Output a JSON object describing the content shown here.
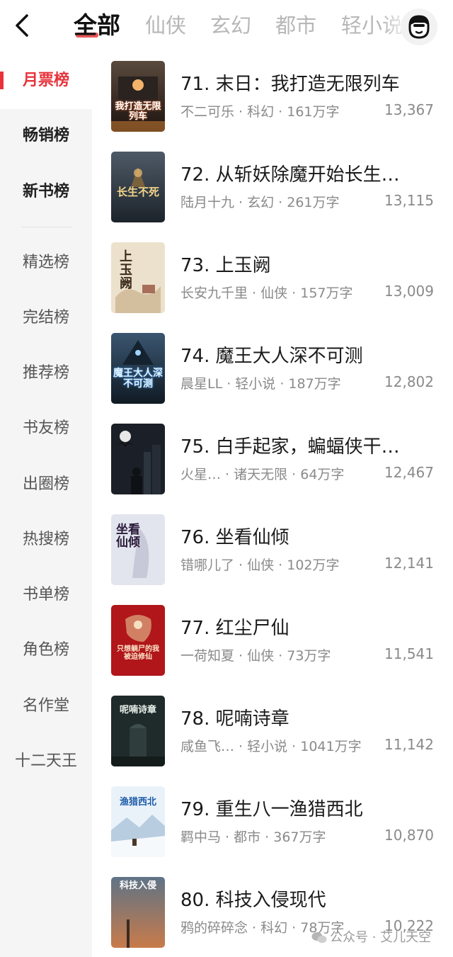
{
  "tabs": [
    {
      "label": "全部",
      "active": true
    },
    {
      "label": "仙侠"
    },
    {
      "label": "玄幻"
    },
    {
      "label": "都市"
    },
    {
      "label": "轻小说"
    }
  ],
  "sidebar": {
    "items": [
      {
        "label": "月票榜",
        "state": "active"
      },
      {
        "label": "畅销榜",
        "state": "bold"
      },
      {
        "label": "新书榜",
        "state": "bold"
      },
      {
        "label": "精选榜"
      },
      {
        "label": "完结榜"
      },
      {
        "label": "推荐榜"
      },
      {
        "label": "书友榜"
      },
      {
        "label": "出圈榜"
      },
      {
        "label": "热搜榜"
      },
      {
        "label": "书单榜"
      },
      {
        "label": "角色榜"
      },
      {
        "label": "名作堂"
      },
      {
        "label": "十二天王"
      }
    ]
  },
  "books": [
    {
      "title": "71. 末日：我打造无限列车",
      "meta": "不二可乐 · 科幻 · 161万字",
      "count": "13,367",
      "cover_text": "我打造无限列车",
      "cover_color": "#3a2a22"
    },
    {
      "title": "72. 从斩妖除魔开始长生…",
      "meta": "陆月十九 · 玄幻 · 261万字",
      "count": "13,115",
      "cover_text": "长生不死",
      "cover_color": "#2c3640"
    },
    {
      "title": "73. 上玉阙",
      "meta": "长安九千里 · 仙侠 · 157万字",
      "count": "13,009",
      "cover_text": "上玉阙",
      "cover_color": "#e9dcc4"
    },
    {
      "title": "74. 魔王大人深不可测",
      "meta": "晨星LL · 轻小说 · 187万字",
      "count": "12,802",
      "cover_text": "魔王大人深不可测",
      "cover_color": "#22384a"
    },
    {
      "title": "75. 白手起家，蝙蝠侠干…",
      "meta": "火星… · 诸天无限 · 64万字",
      "count": "12,467",
      "cover_text": "",
      "cover_color": "#1b2028"
    },
    {
      "title": "76. 坐看仙倾",
      "meta": "错哪儿了 · 仙侠 · 102万字",
      "count": "12,141",
      "cover_text": "坐看仙倾",
      "cover_color": "#d9dce6"
    },
    {
      "title": "77. 红尘尸仙",
      "meta": "一荷知夏 · 仙侠 · 73万字",
      "count": "11,541",
      "cover_text": "只想躺尸的我被迫修仙",
      "cover_color": "#b0161a"
    },
    {
      "title": "78. 呢喃诗章",
      "meta": "咸鱼飞… · 轻小说 · 1041万字",
      "count": "11,142",
      "cover_text": "呢喃诗章",
      "cover_color": "#1f2a2a"
    },
    {
      "title": "79. 重生八一渔猎西北",
      "meta": "羁中马 · 都市 · 367万字",
      "count": "10,870",
      "cover_text": "渔猎西北",
      "cover_color": "#dbe8f3"
    },
    {
      "title": "80. 科技入侵现代",
      "meta": "鸦的碎碎念 · 科幻 · 78万字",
      "count": "10,222",
      "cover_text": "科技入侵",
      "cover_color": "#4a5a6a"
    }
  ],
  "watermark": "公众号 · 艾儿天空",
  "colors": {
    "accent": "#e8333b",
    "sidebar_bg": "#f5f5f5"
  }
}
